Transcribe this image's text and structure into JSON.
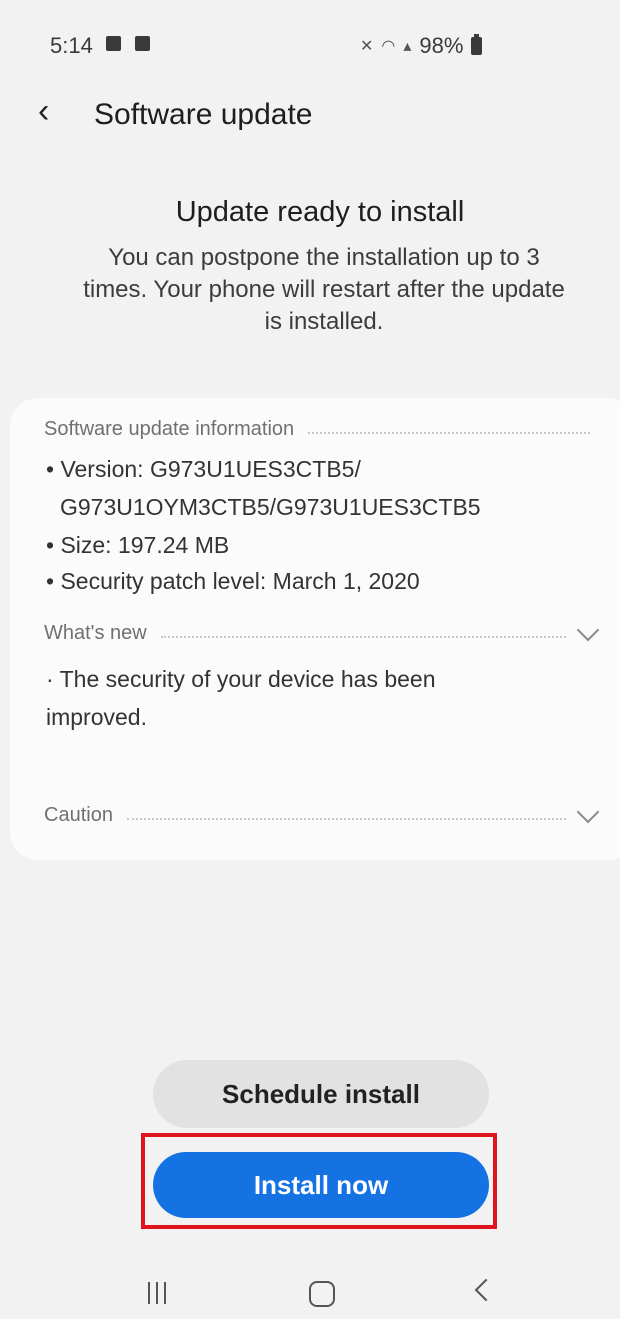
{
  "status_bar": {
    "time": "5:14",
    "battery": "98%",
    "icons": [
      "gallery-icon",
      "checkbox-icon",
      "mute-icon",
      "wifi-icon",
      "signal-icon",
      "battery-icon"
    ]
  },
  "app_bar": {
    "title": "Software update",
    "back_icon": "back-arrow-icon"
  },
  "header": {
    "title": "Update ready to install",
    "description_lines": [
      "You can postpone the installation up to 3",
      "times. Your phone will restart after the update",
      "is installed."
    ]
  },
  "info_card": {
    "info_section_label": "Software update information",
    "version_line1": "• Version: G973U1UES3CTB5/",
    "version_line2": "G973U1OYM3CTB5/G973U1UES3CTB5",
    "size": "• Size: 197.24 MB",
    "security_patch": "• Security patch level: March 1, 2020",
    "whats_new_label": "What's new",
    "whats_new_line1": "· The security of your device has been",
    "whats_new_line2": "improved.",
    "caution_label": "Caution"
  },
  "actions": {
    "schedule_label": "Schedule install",
    "install_label": "Install now"
  },
  "colors": {
    "accent": "#1472e2",
    "highlight": "#e0141c",
    "background": "#f2f2f2"
  }
}
